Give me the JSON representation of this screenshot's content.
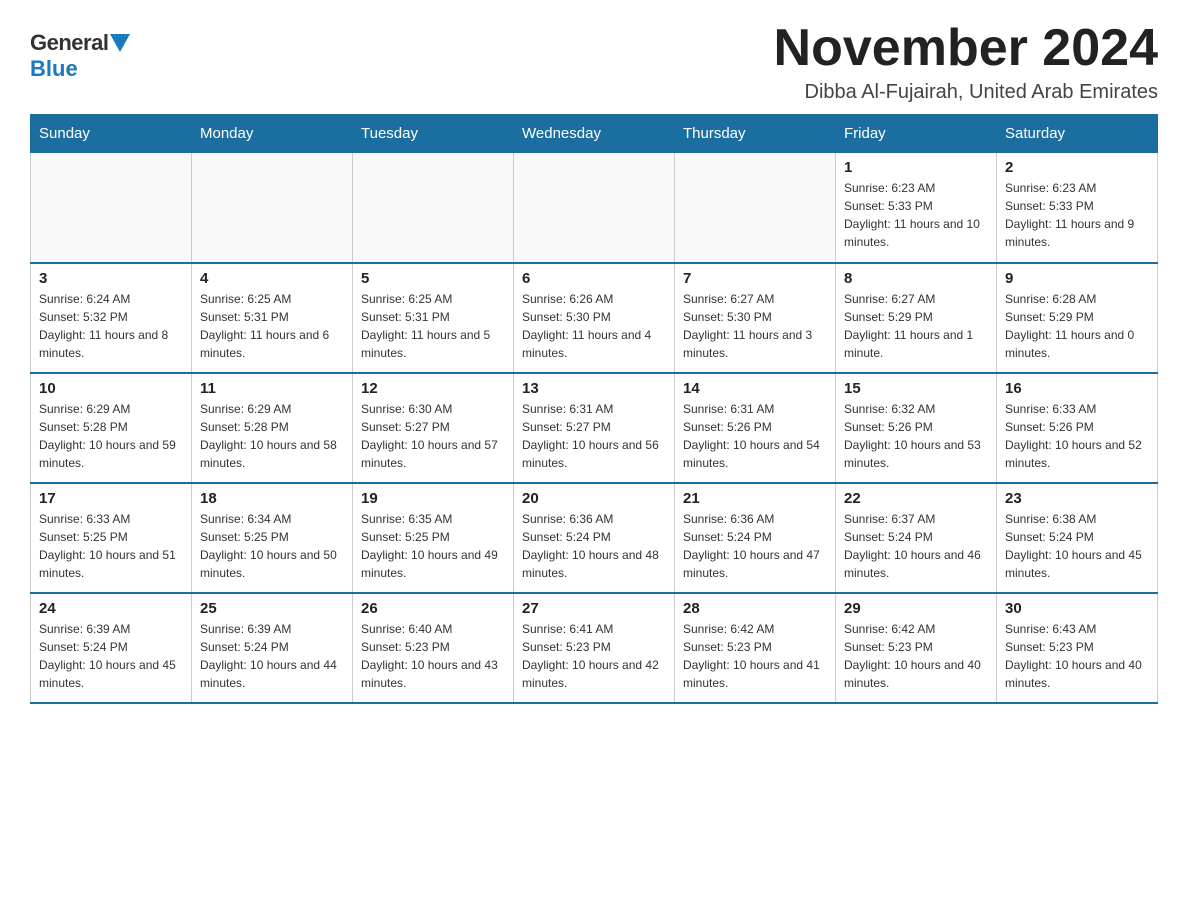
{
  "logo": {
    "general": "General",
    "blue": "Blue"
  },
  "title": {
    "month_year": "November 2024",
    "location": "Dibba Al-Fujairah, United Arab Emirates"
  },
  "weekdays": [
    "Sunday",
    "Monday",
    "Tuesday",
    "Wednesday",
    "Thursday",
    "Friday",
    "Saturday"
  ],
  "weeks": [
    [
      {
        "day": "",
        "info": ""
      },
      {
        "day": "",
        "info": ""
      },
      {
        "day": "",
        "info": ""
      },
      {
        "day": "",
        "info": ""
      },
      {
        "day": "",
        "info": ""
      },
      {
        "day": "1",
        "info": "Sunrise: 6:23 AM\nSunset: 5:33 PM\nDaylight: 11 hours and 10 minutes."
      },
      {
        "day": "2",
        "info": "Sunrise: 6:23 AM\nSunset: 5:33 PM\nDaylight: 11 hours and 9 minutes."
      }
    ],
    [
      {
        "day": "3",
        "info": "Sunrise: 6:24 AM\nSunset: 5:32 PM\nDaylight: 11 hours and 8 minutes."
      },
      {
        "day": "4",
        "info": "Sunrise: 6:25 AM\nSunset: 5:31 PM\nDaylight: 11 hours and 6 minutes."
      },
      {
        "day": "5",
        "info": "Sunrise: 6:25 AM\nSunset: 5:31 PM\nDaylight: 11 hours and 5 minutes."
      },
      {
        "day": "6",
        "info": "Sunrise: 6:26 AM\nSunset: 5:30 PM\nDaylight: 11 hours and 4 minutes."
      },
      {
        "day": "7",
        "info": "Sunrise: 6:27 AM\nSunset: 5:30 PM\nDaylight: 11 hours and 3 minutes."
      },
      {
        "day": "8",
        "info": "Sunrise: 6:27 AM\nSunset: 5:29 PM\nDaylight: 11 hours and 1 minute."
      },
      {
        "day": "9",
        "info": "Sunrise: 6:28 AM\nSunset: 5:29 PM\nDaylight: 11 hours and 0 minutes."
      }
    ],
    [
      {
        "day": "10",
        "info": "Sunrise: 6:29 AM\nSunset: 5:28 PM\nDaylight: 10 hours and 59 minutes."
      },
      {
        "day": "11",
        "info": "Sunrise: 6:29 AM\nSunset: 5:28 PM\nDaylight: 10 hours and 58 minutes."
      },
      {
        "day": "12",
        "info": "Sunrise: 6:30 AM\nSunset: 5:27 PM\nDaylight: 10 hours and 57 minutes."
      },
      {
        "day": "13",
        "info": "Sunrise: 6:31 AM\nSunset: 5:27 PM\nDaylight: 10 hours and 56 minutes."
      },
      {
        "day": "14",
        "info": "Sunrise: 6:31 AM\nSunset: 5:26 PM\nDaylight: 10 hours and 54 minutes."
      },
      {
        "day": "15",
        "info": "Sunrise: 6:32 AM\nSunset: 5:26 PM\nDaylight: 10 hours and 53 minutes."
      },
      {
        "day": "16",
        "info": "Sunrise: 6:33 AM\nSunset: 5:26 PM\nDaylight: 10 hours and 52 minutes."
      }
    ],
    [
      {
        "day": "17",
        "info": "Sunrise: 6:33 AM\nSunset: 5:25 PM\nDaylight: 10 hours and 51 minutes."
      },
      {
        "day": "18",
        "info": "Sunrise: 6:34 AM\nSunset: 5:25 PM\nDaylight: 10 hours and 50 minutes."
      },
      {
        "day": "19",
        "info": "Sunrise: 6:35 AM\nSunset: 5:25 PM\nDaylight: 10 hours and 49 minutes."
      },
      {
        "day": "20",
        "info": "Sunrise: 6:36 AM\nSunset: 5:24 PM\nDaylight: 10 hours and 48 minutes."
      },
      {
        "day": "21",
        "info": "Sunrise: 6:36 AM\nSunset: 5:24 PM\nDaylight: 10 hours and 47 minutes."
      },
      {
        "day": "22",
        "info": "Sunrise: 6:37 AM\nSunset: 5:24 PM\nDaylight: 10 hours and 46 minutes."
      },
      {
        "day": "23",
        "info": "Sunrise: 6:38 AM\nSunset: 5:24 PM\nDaylight: 10 hours and 45 minutes."
      }
    ],
    [
      {
        "day": "24",
        "info": "Sunrise: 6:39 AM\nSunset: 5:24 PM\nDaylight: 10 hours and 45 minutes."
      },
      {
        "day": "25",
        "info": "Sunrise: 6:39 AM\nSunset: 5:24 PM\nDaylight: 10 hours and 44 minutes."
      },
      {
        "day": "26",
        "info": "Sunrise: 6:40 AM\nSunset: 5:23 PM\nDaylight: 10 hours and 43 minutes."
      },
      {
        "day": "27",
        "info": "Sunrise: 6:41 AM\nSunset: 5:23 PM\nDaylight: 10 hours and 42 minutes."
      },
      {
        "day": "28",
        "info": "Sunrise: 6:42 AM\nSunset: 5:23 PM\nDaylight: 10 hours and 41 minutes."
      },
      {
        "day": "29",
        "info": "Sunrise: 6:42 AM\nSunset: 5:23 PM\nDaylight: 10 hours and 40 minutes."
      },
      {
        "day": "30",
        "info": "Sunrise: 6:43 AM\nSunset: 5:23 PM\nDaylight: 10 hours and 40 minutes."
      }
    ]
  ]
}
